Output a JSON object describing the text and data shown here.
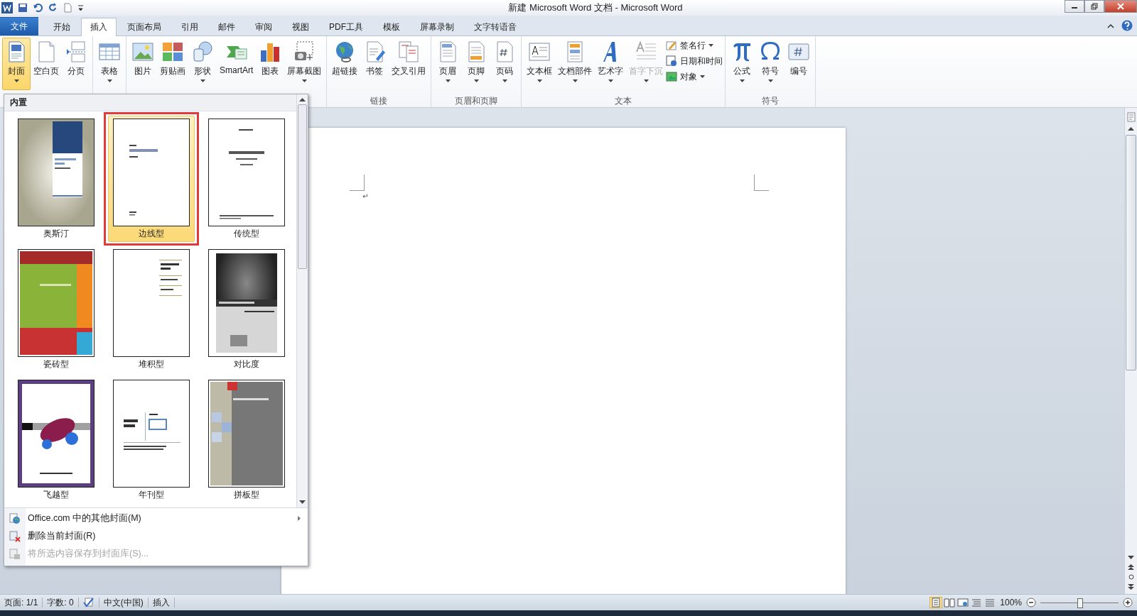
{
  "window": {
    "title": "新建 Microsoft Word 文档 - Microsoft Word"
  },
  "tabs": [
    {
      "label": "文件",
      "kind": "file",
      "selected": false
    },
    {
      "label": "开始",
      "kind": "tab",
      "selected": false
    },
    {
      "label": "插入",
      "kind": "tab",
      "selected": true
    },
    {
      "label": "页面布局",
      "kind": "tab",
      "selected": false
    },
    {
      "label": "引用",
      "kind": "tab",
      "selected": false
    },
    {
      "label": "邮件",
      "kind": "tab",
      "selected": false
    },
    {
      "label": "审阅",
      "kind": "tab",
      "selected": false
    },
    {
      "label": "视图",
      "kind": "tab",
      "selected": false
    },
    {
      "label": "PDF工具",
      "kind": "tab",
      "selected": false
    },
    {
      "label": "模板",
      "kind": "tab",
      "selected": false
    },
    {
      "label": "屏幕录制",
      "kind": "tab",
      "selected": false
    },
    {
      "label": "文字转语音",
      "kind": "tab",
      "selected": false
    }
  ],
  "ribbon": {
    "groups": [
      {
        "buttons": [
          {
            "label": "封面",
            "kind": "large",
            "dropdown": true,
            "selected": true,
            "disabled": false
          },
          {
            "label": "空白页",
            "kind": "large",
            "dropdown": false,
            "selected": false,
            "disabled": false
          },
          {
            "label": "分页",
            "kind": "large",
            "dropdown": false,
            "selected": false,
            "disabled": false
          }
        ]
      },
      {
        "buttons": [
          {
            "label": "表格",
            "kind": "large",
            "dropdown": true,
            "selected": false,
            "disabled": false
          }
        ]
      },
      {
        "buttons": [
          {
            "label": "图片",
            "kind": "large",
            "dropdown": false,
            "selected": false,
            "disabled": false
          },
          {
            "label": "剪贴画",
            "kind": "large",
            "dropdown": false,
            "selected": false,
            "disabled": false
          },
          {
            "label": "形状",
            "kind": "large",
            "dropdown": true,
            "selected": false,
            "disabled": false
          },
          {
            "label": "SmartArt",
            "kind": "large",
            "dropdown": false,
            "selected": false,
            "disabled": false
          },
          {
            "label": "图表",
            "kind": "large",
            "dropdown": false,
            "selected": false,
            "disabled": false
          },
          {
            "label": "屏幕截图",
            "kind": "large",
            "dropdown": true,
            "selected": false,
            "disabled": false
          }
        ]
      },
      {
        "label": "链接",
        "buttons": [
          {
            "label": "超链接",
            "kind": "large",
            "dropdown": false,
            "selected": false,
            "disabled": false
          },
          {
            "label": "书签",
            "kind": "large",
            "dropdown": false,
            "selected": false,
            "disabled": false
          },
          {
            "label": "交叉引用",
            "kind": "large",
            "dropdown": false,
            "selected": false,
            "disabled": false
          }
        ]
      },
      {
        "label": "页眉和页脚",
        "buttons": [
          {
            "label": "页眉",
            "kind": "large",
            "dropdown": true,
            "selected": false,
            "disabled": false
          },
          {
            "label": "页脚",
            "kind": "large",
            "dropdown": true,
            "selected": false,
            "disabled": false
          },
          {
            "label": "页码",
            "kind": "large",
            "dropdown": true,
            "selected": false,
            "disabled": false
          }
        ]
      },
      {
        "label": "文本",
        "buttons": [
          {
            "label": "文本框",
            "kind": "large",
            "dropdown": true,
            "selected": false,
            "disabled": false
          },
          {
            "label": "文档部件",
            "kind": "large",
            "dropdown": true,
            "selected": false,
            "disabled": false
          },
          {
            "label": "艺术字",
            "kind": "large",
            "dropdown": true,
            "selected": false,
            "disabled": false
          },
          {
            "label": "首字下沉",
            "kind": "large",
            "dropdown": true,
            "selected": false,
            "disabled": true
          },
          {
            "label": "签名行",
            "kind": "small",
            "dropdown": true,
            "selected": false,
            "disabled": false
          },
          {
            "label": "日期和时间",
            "kind": "small",
            "dropdown": false,
            "selected": false,
            "disabled": false
          },
          {
            "label": "对象",
            "kind": "small",
            "dropdown": true,
            "selected": false,
            "disabled": false
          }
        ]
      },
      {
        "label": "符号",
        "buttons": [
          {
            "label": "公式",
            "kind": "large",
            "dropdown": true,
            "selected": false,
            "disabled": false
          },
          {
            "label": "符号",
            "kind": "large",
            "dropdown": true,
            "selected": false,
            "disabled": false
          },
          {
            "label": "编号",
            "kind": "large",
            "dropdown": false,
            "selected": false,
            "disabled": false
          }
        ]
      }
    ]
  },
  "cover_gallery": {
    "heading": "内置",
    "items": [
      {
        "label": "奥斯汀",
        "kind": "austin",
        "selected": false
      },
      {
        "label": "边线型",
        "kind": "sideline",
        "selected": true
      },
      {
        "label": "传统型",
        "kind": "traditional",
        "selected": false
      },
      {
        "label": "瓷砖型",
        "kind": "tiles",
        "selected": false
      },
      {
        "label": "堆积型",
        "kind": "stacks",
        "selected": false
      },
      {
        "label": "对比度",
        "kind": "contrast",
        "selected": false
      },
      {
        "label": "飞越型",
        "kind": "motion",
        "selected": false
      },
      {
        "label": "年刊型",
        "kind": "annual",
        "selected": false
      },
      {
        "label": "拼板型",
        "kind": "puzzle",
        "selected": false
      }
    ],
    "menu": [
      {
        "label": "Office.com 中的其他封面(M)",
        "submenu": true,
        "disabled": false
      },
      {
        "label": "删除当前封面(R)",
        "submenu": false,
        "disabled": false
      },
      {
        "label": "将所选内容保存到封面库(S)...",
        "submenu": false,
        "disabled": true
      }
    ]
  },
  "document": {
    "paragraph_mark": "↵"
  },
  "status_bar": {
    "items": [
      "页面: 1/1",
      "字数: 0",
      "中文(中国)",
      "插入"
    ],
    "zoom": "100%",
    "zoom_slider": {
      "level": 0.5
    }
  }
}
